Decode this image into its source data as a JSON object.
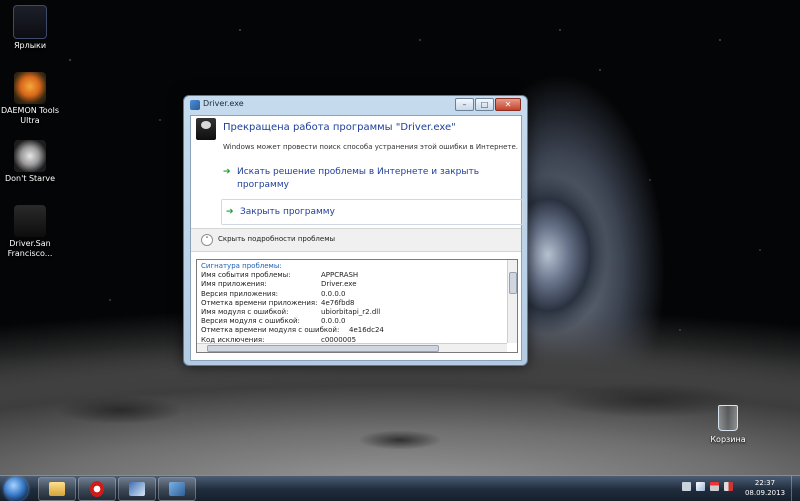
{
  "desktop": {
    "icons": [
      {
        "label": "Ярлыки",
        "icon": "shortcuts-folder-icon"
      },
      {
        "label": "DAEMON Tools Ultra",
        "icon": "daemon-tools-icon"
      },
      {
        "label": "Don't Starve",
        "icon": "dont-starve-icon"
      },
      {
        "label": "Driver.San Francisco...",
        "icon": "driver-game-icon"
      }
    ],
    "recycle_bin": {
      "label": "Корзина",
      "icon": "recycle-bin-icon"
    }
  },
  "dialog": {
    "title": "Driver.exe",
    "controls": {
      "minimize": "–",
      "maximize": "□",
      "close": "✕"
    },
    "headline": "Прекращена работа программы \"Driver.exe\"",
    "subline": "Windows может провести поиск способа устранения этой ошибки в Интернете.",
    "commands": [
      {
        "arrow": "➔",
        "label": "Искать решение проблемы в Интернете и закрыть программу"
      },
      {
        "arrow": "➔",
        "label": "Закрыть программу"
      }
    ],
    "details_toggle": {
      "chevron": "˄",
      "label": "Скрыть подробности проблемы"
    },
    "details": {
      "title": "Сигнатура проблемы:",
      "rows": [
        {
          "key": "Имя события проблемы:",
          "value": "APPCRASH"
        },
        {
          "key": "Имя приложения:",
          "value": "Driver.exe"
        },
        {
          "key": "Версия приложения:",
          "value": "0.0.0.0"
        },
        {
          "key": "Отметка времени приложения:",
          "value": "4e76fbd8"
        },
        {
          "key": "Имя модуля с ошибкой:",
          "value": "ubiorbitapi_r2.dll"
        },
        {
          "key": "Версия модуля с ошибкой:",
          "value": "0.0.0.0"
        },
        {
          "key": "Отметка времени модуля с ошибкой:",
          "value": "4e16dc24"
        },
        {
          "key": "Код исключения:",
          "value": "c0000005"
        }
      ]
    }
  },
  "taskbar": {
    "buttons": [
      {
        "icon": "explorer-folder-icon"
      },
      {
        "icon": "opera-browser-icon"
      },
      {
        "icon": "application-icon"
      },
      {
        "icon": "error-reporting-icon"
      }
    ],
    "clock": {
      "time": "22:37",
      "date": "08.09.2013"
    }
  }
}
